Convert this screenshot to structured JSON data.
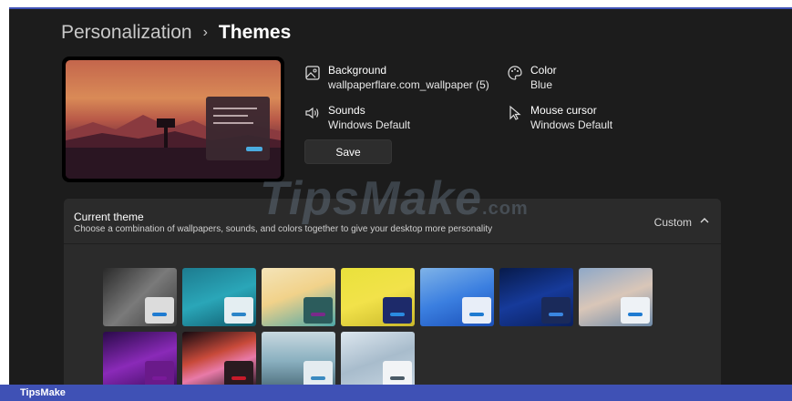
{
  "breadcrumb": {
    "parent": "Personalization",
    "separator": "›",
    "current": "Themes"
  },
  "properties": {
    "background": {
      "title": "Background",
      "value": "wallpaperflare.com_wallpaper (5)",
      "icon": "image-icon"
    },
    "color": {
      "title": "Color",
      "value": "Blue",
      "icon": "palette-icon"
    },
    "sounds": {
      "title": "Sounds",
      "value": "Windows Default",
      "icon": "speaker-icon"
    },
    "cursor": {
      "title": "Mouse cursor",
      "value": "Windows Default",
      "icon": "cursor-icon"
    }
  },
  "save_label": "Save",
  "current_theme": {
    "title": "Current theme",
    "description": "Choose a combination of wallpapers, sounds, and colors together to give your desktop more personality",
    "status": "Custom"
  },
  "themes": [
    {
      "bg": "linear-gradient(135deg,#2a2a2a,#7a7a7a 50%,#3a3a3a)",
      "win": "#dcdcdc",
      "accent": "#1f7bd1"
    },
    {
      "bg": "linear-gradient(160deg,#1d7b8f,#2aa6b8 50%,#0f5a6c)",
      "win": "#e4eef2",
      "accent": "#2a84c8"
    },
    {
      "bg": "linear-gradient(160deg,#f4e4b8,#f1d28a 45%,#4ea7a7)",
      "win": "#2c5c5c",
      "accent": "#7a2a8a"
    },
    {
      "bg": "linear-gradient(160deg,#e9e13b,#f2e24a 50%,#c9b82a)",
      "win": "#1d2a6a",
      "accent": "#2a8ae0"
    },
    {
      "bg": "linear-gradient(160deg,#7fb3e8,#3b7fe0 50%,#1a4fb8)",
      "win": "#e8eef8",
      "accent": "#1f7bd1"
    },
    {
      "bg": "linear-gradient(160deg,#071a4a,#163a9a 50%,#0a1f5c)",
      "win": "#1a2a5a",
      "accent": "#3a86e0"
    },
    {
      "bg": "linear-gradient(160deg,#8ea8c8,#d9c6b8 50%,#6e8aa8)",
      "win": "#eef2f6",
      "accent": "#1f7bd1"
    },
    {
      "bg": "linear-gradient(160deg,#2a0a4a,#8a2ab8 50%,#3a0a5a)",
      "win": "#6a1a8a",
      "accent": "#7a1a9a"
    },
    {
      "bg": "linear-gradient(160deg,#140a10,#c84a3a 40%,#e87aa8 60%,#1a1018)",
      "win": "#2a1a20",
      "accent": "#c81a2a"
    },
    {
      "bg": "linear-gradient(180deg,#c8d8e0,#8ab0c0 50%,#4a6a78)",
      "win": "#e4ecf0",
      "accent": "#3a8ac0"
    },
    {
      "bg": "linear-gradient(160deg,#dce6ee,#a8bccc 50%,#c8d6e2)",
      "win": "#f2f4f6",
      "accent": "#4a5a66"
    }
  ],
  "watermark": {
    "main": "TipsMake",
    "suffix": ".com"
  },
  "brand": "TipsMake"
}
